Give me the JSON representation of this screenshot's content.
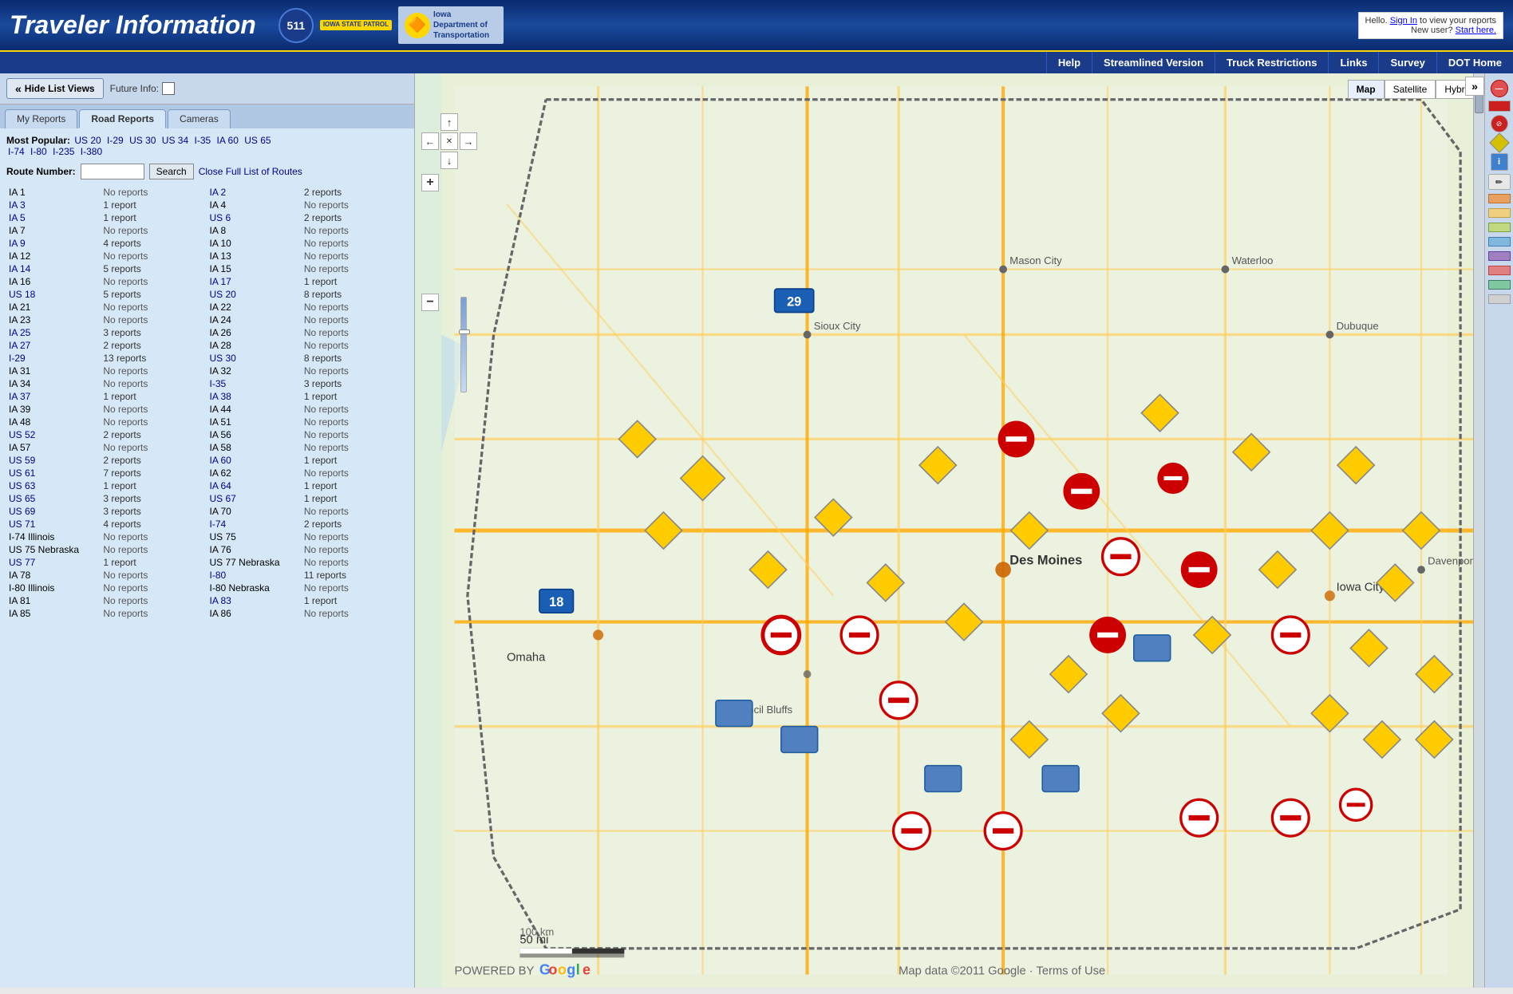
{
  "header": {
    "title": "Traveler Information",
    "logo511": "511",
    "logoStatePatrol": "IOWA STATE PATROL",
    "logoDOT": "Iowa Department of Transportation",
    "helloText": "Hello.",
    "signInText": "Sign In",
    "toViewText": " to view your reports",
    "newUserText": "New user?",
    "startHereText": "Start here."
  },
  "navbar": {
    "items": [
      {
        "label": "Help",
        "href": "#"
      },
      {
        "label": "Streamlined Version",
        "href": "#"
      },
      {
        "label": "Truck Restrictions",
        "href": "#"
      },
      {
        "label": "Links",
        "href": "#"
      },
      {
        "label": "Survey",
        "href": "#"
      },
      {
        "label": "DOT Home",
        "href": "#"
      }
    ]
  },
  "toolbar": {
    "hideListLabel": "Hide List Views",
    "futureInfoLabel": "Future Info:"
  },
  "tabs": [
    {
      "label": "My Reports",
      "active": false
    },
    {
      "label": "Road Reports",
      "active": true
    },
    {
      "label": "Cameras",
      "active": false
    }
  ],
  "popular": {
    "label": "Most Popular:",
    "routes": [
      {
        "label": "US 20",
        "href": "#"
      },
      {
        "label": "I-29",
        "href": "#"
      },
      {
        "label": "US 30",
        "href": "#"
      },
      {
        "label": "US 34",
        "href": "#"
      },
      {
        "label": "I-35",
        "href": "#"
      },
      {
        "label": "IA 60",
        "href": "#"
      },
      {
        "label": "US 65",
        "href": "#"
      },
      {
        "label": "I-74",
        "href": "#"
      },
      {
        "label": "I-80",
        "href": "#"
      },
      {
        "label": "I-235",
        "href": "#"
      },
      {
        "label": "I-380",
        "href": "#"
      }
    ]
  },
  "routeSearch": {
    "label": "Route Number:",
    "placeholder": "",
    "buttonLabel": "Search",
    "closeFullListLabel": "Close Full List of Routes"
  },
  "routes": [
    {
      "col1": {
        "label": "IA 1",
        "link": false
      },
      "col1r": "No reports",
      "col2": {
        "label": "IA 2",
        "link": true
      },
      "col2r": "2 reports"
    },
    {
      "col1": {
        "label": "IA 3",
        "link": true
      },
      "col1r": "1 report",
      "col2": {
        "label": "IA 4",
        "link": false
      },
      "col2r": "No reports"
    },
    {
      "col1": {
        "label": "IA 5",
        "link": true
      },
      "col1r": "1 report",
      "col2": {
        "label": "US 6",
        "link": true
      },
      "col2r": "2 reports"
    },
    {
      "col1": {
        "label": "IA 7",
        "link": false
      },
      "col1r": "No reports",
      "col2": {
        "label": "IA 8",
        "link": false
      },
      "col2r": "No reports"
    },
    {
      "col1": {
        "label": "IA 9",
        "link": true
      },
      "col1r": "4 reports",
      "col2": {
        "label": "IA 10",
        "link": false
      },
      "col2r": "No reports"
    },
    {
      "col1": {
        "label": "IA 12",
        "link": false
      },
      "col1r": "No reports",
      "col2": {
        "label": "IA 13",
        "link": false
      },
      "col2r": "No reports"
    },
    {
      "col1": {
        "label": "IA 14",
        "link": true
      },
      "col1r": "5 reports",
      "col2": {
        "label": "IA 15",
        "link": false
      },
      "col2r": "No reports"
    },
    {
      "col1": {
        "label": "IA 16",
        "link": false
      },
      "col1r": "No reports",
      "col2": {
        "label": "IA 17",
        "link": true
      },
      "col2r": "1 report"
    },
    {
      "col1": {
        "label": "US 18",
        "link": true
      },
      "col1r": "5 reports",
      "col2": {
        "label": "US 20",
        "link": true
      },
      "col2r": "8 reports"
    },
    {
      "col1": {
        "label": "IA 21",
        "link": false
      },
      "col1r": "No reports",
      "col2": {
        "label": "IA 22",
        "link": false
      },
      "col2r": "No reports"
    },
    {
      "col1": {
        "label": "IA 23",
        "link": false
      },
      "col1r": "No reports",
      "col2": {
        "label": "IA 24",
        "link": false
      },
      "col2r": "No reports"
    },
    {
      "col1": {
        "label": "IA 25",
        "link": true
      },
      "col1r": "3 reports",
      "col2": {
        "label": "IA 26",
        "link": false
      },
      "col2r": "No reports"
    },
    {
      "col1": {
        "label": "IA 27",
        "link": true
      },
      "col1r": "2 reports",
      "col2": {
        "label": "IA 28",
        "link": false
      },
      "col2r": "No reports"
    },
    {
      "col1": {
        "label": "I-29",
        "link": true
      },
      "col1r": "13 reports",
      "col2": {
        "label": "US 30",
        "link": true
      },
      "col2r": "8 reports"
    },
    {
      "col1": {
        "label": "IA 31",
        "link": false
      },
      "col1r": "No reports",
      "col2": {
        "label": "IA 32",
        "link": false
      },
      "col2r": "No reports"
    },
    {
      "col1": {
        "label": "IA 34",
        "link": false
      },
      "col1r": "No reports",
      "col2": {
        "label": "I-35",
        "link": true
      },
      "col2r": "3 reports"
    },
    {
      "col1": {
        "label": "IA 37",
        "link": true
      },
      "col1r": "1 report",
      "col2": {
        "label": "IA 38",
        "link": true
      },
      "col2r": "1 report"
    },
    {
      "col1": {
        "label": "IA 39",
        "link": false
      },
      "col1r": "No reports",
      "col2": {
        "label": "IA 44",
        "link": false
      },
      "col2r": "No reports"
    },
    {
      "col1": {
        "label": "IA 48",
        "link": false
      },
      "col1r": "No reports",
      "col2": {
        "label": "IA 51",
        "link": false
      },
      "col2r": "No reports"
    },
    {
      "col1": {
        "label": "US 52",
        "link": true
      },
      "col1r": "2 reports",
      "col2": {
        "label": "IA 56",
        "link": false
      },
      "col2r": "No reports"
    },
    {
      "col1": {
        "label": "IA 57",
        "link": false
      },
      "col1r": "No reports",
      "col2": {
        "label": "IA 58",
        "link": false
      },
      "col2r": "No reports"
    },
    {
      "col1": {
        "label": "US 59",
        "link": true
      },
      "col1r": "2 reports",
      "col2": {
        "label": "IA 60",
        "link": true
      },
      "col2r": "1 report"
    },
    {
      "col1": {
        "label": "US 61",
        "link": true
      },
      "col1r": "7 reports",
      "col2": {
        "label": "IA 62",
        "link": false
      },
      "col2r": "No reports"
    },
    {
      "col1": {
        "label": "US 63",
        "link": true
      },
      "col1r": "1 report",
      "col2": {
        "label": "IA 64",
        "link": true
      },
      "col2r": "1 report"
    },
    {
      "col1": {
        "label": "US 65",
        "link": true
      },
      "col1r": "3 reports",
      "col2": {
        "label": "US 67",
        "link": true
      },
      "col2r": "1 report"
    },
    {
      "col1": {
        "label": "US 69",
        "link": true
      },
      "col1r": "3 reports",
      "col2": {
        "label": "IA 70",
        "link": false
      },
      "col2r": "No reports"
    },
    {
      "col1": {
        "label": "US 71",
        "link": true
      },
      "col1r": "4 reports",
      "col2": {
        "label": "I-74",
        "link": true
      },
      "col2r": "2 reports"
    },
    {
      "col1": {
        "label": "I-74 Illinois",
        "link": false
      },
      "col1r": "No reports",
      "col2": {
        "label": "US 75",
        "link": false
      },
      "col2r": "No reports"
    },
    {
      "col1": {
        "label": "US 75 Nebraska",
        "link": false
      },
      "col1r": "No reports",
      "col2": {
        "label": "IA 76",
        "link": false
      },
      "col2r": "No reports"
    },
    {
      "col1": {
        "label": "US 77",
        "link": true
      },
      "col1r": "1 report",
      "col2": {
        "label": "US 77 Nebraska",
        "link": false
      },
      "col2r": "No reports"
    },
    {
      "col1": {
        "label": "IA 78",
        "link": false
      },
      "col1r": "No reports",
      "col2": {
        "label": "I-80",
        "link": true
      },
      "col2r": "11 reports"
    },
    {
      "col1": {
        "label": "I-80 Illinois",
        "link": false
      },
      "col1r": "No reports",
      "col2": {
        "label": "I-80 Nebraska",
        "link": false
      },
      "col2r": "No reports"
    },
    {
      "col1": {
        "label": "IA 81",
        "link": false
      },
      "col1r": "No reports",
      "col2": {
        "label": "IA 83",
        "link": true
      },
      "col2r": "1 report"
    },
    {
      "col1": {
        "label": "IA 85",
        "link": false
      },
      "col1r": "No reports",
      "col2": {
        "label": "IA 86",
        "link": false
      },
      "col2r": "No reports"
    }
  ],
  "map": {
    "types": [
      "Map",
      "Satellite",
      "Hybrid"
    ],
    "activeType": "Map",
    "attribution": "Map data ©2011 Google",
    "termsLabel": "Terms of Use",
    "scaleLabel": "50 mi / 100 km",
    "poweredBy": "POWERED BY"
  },
  "rightSidebar": {
    "icons": [
      {
        "type": "red-circle",
        "label": "road-closed"
      },
      {
        "type": "red-rect",
        "label": "restriction"
      },
      {
        "type": "no-entry",
        "label": "no-entry"
      },
      {
        "type": "diamond",
        "label": "construction"
      },
      {
        "type": "info",
        "label": "info"
      },
      {
        "type": "blue",
        "label": "camera"
      },
      {
        "type": "color1",
        "label": "color1"
      },
      {
        "type": "color2",
        "label": "color2"
      },
      {
        "type": "color3",
        "label": "color3"
      },
      {
        "type": "color4",
        "label": "color4"
      },
      {
        "type": "color5",
        "label": "color5"
      },
      {
        "type": "color6",
        "label": "color6"
      },
      {
        "type": "color7",
        "label": "color7"
      },
      {
        "type": "color8",
        "label": "color8"
      }
    ]
  }
}
